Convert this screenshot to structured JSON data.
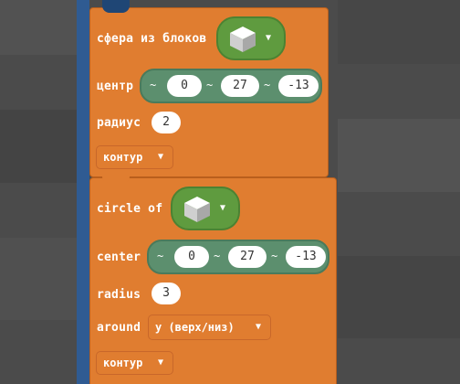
{
  "block1": {
    "title": "сфера из блоков",
    "center_label": "центр",
    "center_x": "0",
    "center_y": "27",
    "center_z": "-13",
    "radius_label": "радиус",
    "radius": "2",
    "mode": "контур"
  },
  "block2": {
    "title": "circle of",
    "center_label": "center",
    "center_x": "0",
    "center_y": "27",
    "center_z": "-13",
    "radius_label": "radius",
    "radius": "3",
    "around_label": "around",
    "axis": "y (верх/низ)",
    "mode": "контур"
  },
  "glyphs": {
    "tilde": "~",
    "arrow": "▼"
  },
  "colors": {
    "block": "#e07d30",
    "block_border": "#b95f1c",
    "block_picker": "#5f9b3f",
    "vector": "#5c8f6e",
    "background": "#4b4b4b"
  },
  "icons": [
    "cube-icon",
    "chevron-down-icon"
  ]
}
